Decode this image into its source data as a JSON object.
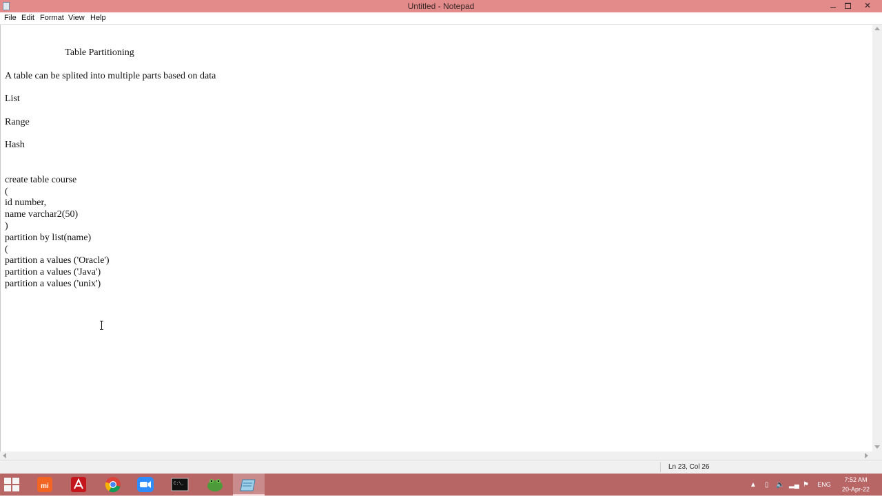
{
  "window": {
    "title": "Untitled - Notepad"
  },
  "menu": [
    "File",
    "Edit",
    "Format",
    "View",
    "Help"
  ],
  "document": {
    "lines": [
      "                         Table Partitioning",
      "",
      "A table can be splited into multiple parts based on data",
      "",
      "List",
      "",
      "Range",
      "",
      "Hash",
      "",
      "",
      "create table course",
      "(",
      "id number,",
      "name varchar2(50)",
      ")",
      "partition by list(name)",
      "(",
      "partition a values ('Oracle')",
      "partition a values ('Java')",
      "partition a values ('unix')"
    ]
  },
  "status": {
    "position": "Ln 23, Col 26"
  },
  "taskbar": {
    "apps": [
      {
        "name": "mi-icon",
        "color": "#f26522"
      },
      {
        "name": "adobe-reader-icon",
        "color": "#c4161c"
      },
      {
        "name": "chrome-icon",
        "color": "#4285f4"
      },
      {
        "name": "zoom-icon",
        "color": "#2d8cff"
      },
      {
        "name": "command-prompt-icon",
        "color": "#111111"
      },
      {
        "name": "toad-icon",
        "color": "#4b9b3a"
      },
      {
        "name": "notepad-icon",
        "color": "#9fd0ea"
      }
    ],
    "language": "ENG",
    "time": "7:52 AM",
    "date": "20-Apr-22"
  }
}
